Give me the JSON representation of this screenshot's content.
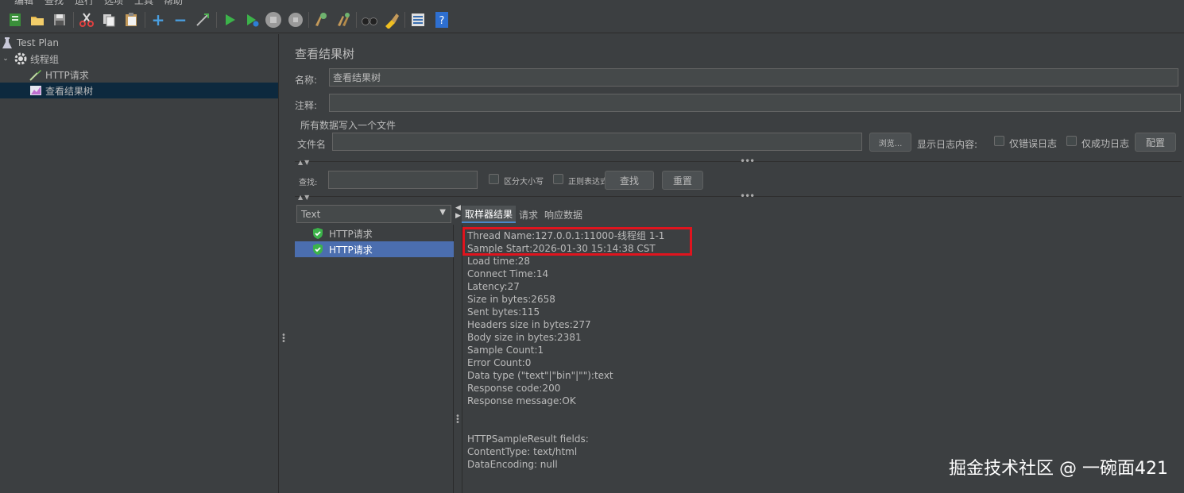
{
  "menu": [
    "编辑",
    "查找",
    "运行",
    "选项",
    "工具",
    "帮助"
  ],
  "toolbar": {
    "icons": [
      "template-icon",
      "open-icon",
      "save-icon",
      "cut-icon",
      "copy-icon",
      "paste-icon",
      "expand-icon",
      "collapse-icon",
      "toggle-icon",
      "start-icon",
      "start-no-pause-icon",
      "stop-icon",
      "shutdown-icon",
      "clear-icon",
      "clear-all-icon",
      "search-icon",
      "reset-search-icon",
      "function-helper-icon",
      "help-icon"
    ]
  },
  "tree": {
    "items": [
      {
        "label": "Test Plan",
        "icon": "test-plan-icon"
      },
      {
        "label": "线程组",
        "icon": "gear-icon"
      },
      {
        "label": "HTTP请求",
        "icon": "pipette-icon"
      },
      {
        "label": "查看结果树",
        "icon": "chart-icon"
      }
    ]
  },
  "panel": {
    "title": "查看结果树",
    "name_label": "名称:",
    "name_value": "查看结果树",
    "comment_label": "注释:",
    "comment_value": "",
    "file_section": "所有数据写入一个文件",
    "filename_label": "文件名",
    "filename_value": "",
    "browse_label": "浏览...",
    "log_label": "显示日志内容:",
    "errors_only": "仅错误日志",
    "success_only": "仅成功日志",
    "configure": "配置",
    "search_label": "查找:",
    "search_value": "",
    "case_sensitive": "区分大小写",
    "regex": "正则表达式",
    "find_button": "查找",
    "reset_button": "重置"
  },
  "results": {
    "renderer": "Text",
    "samples": [
      "HTTP请求",
      "HTTP请求"
    ],
    "tabs": [
      "取样器结果",
      "请求",
      "响应数据"
    ],
    "lines": [
      "Thread Name:127.0.0.1:11000-线程组 1-1",
      "Sample Start:2026-01-30 15:14:38 CST",
      "Load time:28",
      "Connect Time:14",
      "Latency:27",
      "Size in bytes:2658",
      "Sent bytes:115",
      "Headers size in bytes:277",
      "Body size in bytes:2381",
      "Sample Count:1",
      "Error Count:0",
      "Data type (\"text\"|\"bin\"|\"\"):text",
      "Response code:200",
      "Response message:OK",
      "",
      "",
      "HTTPSampleResult fields:",
      "ContentType: text/html",
      "DataEncoding: null"
    ]
  },
  "watermark": "掘金技术社区 @ 一碗面421"
}
